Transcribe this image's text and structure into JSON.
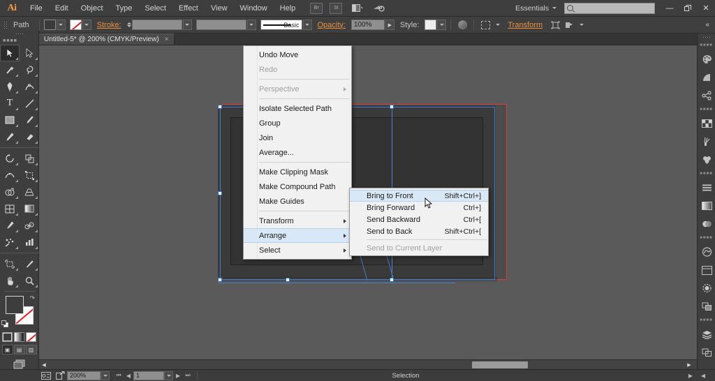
{
  "app": {
    "name": "Adobe Illustrator",
    "logo_text": "Ai"
  },
  "menubar": {
    "items": [
      {
        "label": "File"
      },
      {
        "label": "Edit"
      },
      {
        "label": "Object"
      },
      {
        "label": "Type"
      },
      {
        "label": "Select"
      },
      {
        "label": "Effect"
      },
      {
        "label": "View"
      },
      {
        "label": "Window"
      },
      {
        "label": "Help"
      }
    ],
    "bridge_label": "Br",
    "stock_label": "St",
    "workspace_label": "Essentials",
    "search_placeholder": "",
    "search_value": "",
    "window_minimize": "—",
    "window_restore": "❐",
    "window_close": "✕"
  },
  "controlbar": {
    "object_label": "Path",
    "stroke_label": "Stroke:",
    "stroke_weight": "",
    "stroke_profile": "",
    "brush_label": "Basic",
    "opacity_label": "Opacity:",
    "opacity_value": "100%",
    "style_label": "Style:",
    "transform_label": "Transform",
    "fill_color": "#3d3d3d",
    "stroke_color": "none"
  },
  "document": {
    "tab_title": "Untitled-5* @ 200% (CMYK/Preview)",
    "tab_close": "×"
  },
  "toolbar": {
    "tools": [
      {
        "name": "selection-tool",
        "glyph": "⬈",
        "active": true
      },
      {
        "name": "direct-selection-tool",
        "glyph": "⬈",
        "active": false
      },
      {
        "name": "magic-wand-tool",
        "glyph": "✦",
        "active": false
      },
      {
        "name": "lasso-tool",
        "glyph": "℘",
        "active": false
      },
      {
        "name": "pen-tool",
        "glyph": "✒",
        "active": false
      },
      {
        "name": "curvature-tool",
        "glyph": "∿",
        "active": false
      },
      {
        "name": "type-tool",
        "glyph": "T",
        "active": false
      },
      {
        "name": "line-segment-tool",
        "glyph": "╱",
        "active": false
      },
      {
        "name": "rectangle-tool",
        "glyph": "■",
        "active": false
      },
      {
        "name": "paintbrush-tool",
        "glyph": "✐",
        "active": false
      },
      {
        "name": "pencil-tool",
        "glyph": "✎",
        "active": false
      },
      {
        "name": "eraser-tool",
        "glyph": "▱",
        "active": false
      },
      {
        "name": "rotate-tool",
        "glyph": "↺",
        "active": false
      },
      {
        "name": "scale-tool",
        "glyph": "⧉",
        "active": false
      },
      {
        "name": "width-tool",
        "glyph": "∼",
        "active": false
      },
      {
        "name": "free-transform-tool",
        "glyph": "⬚",
        "active": false
      },
      {
        "name": "shape-builder-tool",
        "glyph": "◔",
        "active": false
      },
      {
        "name": "perspective-grid-tool",
        "glyph": "▦",
        "active": false
      },
      {
        "name": "mesh-tool",
        "glyph": "▓",
        "active": false
      },
      {
        "name": "gradient-tool",
        "glyph": "▧",
        "active": false
      },
      {
        "name": "eyedropper-tool",
        "glyph": "⚗",
        "active": false
      },
      {
        "name": "blend-tool",
        "glyph": "⦸",
        "active": false
      },
      {
        "name": "symbol-sprayer-tool",
        "glyph": "⁂",
        "active": false
      },
      {
        "name": "column-graph-tool",
        "glyph": "ᴵ",
        "active": false
      },
      {
        "name": "artboard-tool",
        "glyph": "⬚",
        "active": false
      },
      {
        "name": "slice-tool",
        "glyph": "╱",
        "active": false
      },
      {
        "name": "hand-tool",
        "glyph": "✋",
        "active": false
      },
      {
        "name": "zoom-tool",
        "glyph": "⚲",
        "active": false
      }
    ]
  },
  "canvas": {
    "artboard_border_color": "#e03b34",
    "artwork_fill": "#3a3a3a",
    "artwork_inner_fill": "#333333",
    "selection_color": "#3b7ddd"
  },
  "context_menu": {
    "items": [
      {
        "label": "Undo Move",
        "disabled": false,
        "submenu": false,
        "highlighted": false
      },
      {
        "label": "Redo",
        "disabled": true,
        "submenu": false,
        "highlighted": false
      },
      {
        "divider": true
      },
      {
        "label": "Perspective",
        "disabled": true,
        "submenu": true,
        "highlighted": false
      },
      {
        "divider": true
      },
      {
        "label": "Isolate Selected Path",
        "disabled": false,
        "submenu": false,
        "highlighted": false
      },
      {
        "label": "Group",
        "disabled": false,
        "submenu": false,
        "highlighted": false
      },
      {
        "label": "Join",
        "disabled": false,
        "submenu": false,
        "highlighted": false
      },
      {
        "label": "Average...",
        "disabled": false,
        "submenu": false,
        "highlighted": false
      },
      {
        "divider": true
      },
      {
        "label": "Make Clipping Mask",
        "disabled": false,
        "submenu": false,
        "highlighted": false
      },
      {
        "label": "Make Compound Path",
        "disabled": false,
        "submenu": false,
        "highlighted": false
      },
      {
        "label": "Make Guides",
        "disabled": false,
        "submenu": false,
        "highlighted": false
      },
      {
        "divider": true
      },
      {
        "label": "Transform",
        "disabled": false,
        "submenu": true,
        "highlighted": false
      },
      {
        "label": "Arrange",
        "disabled": false,
        "submenu": true,
        "highlighted": true
      },
      {
        "label": "Select",
        "disabled": false,
        "submenu": true,
        "highlighted": false
      }
    ]
  },
  "submenu": {
    "items": [
      {
        "label": "Bring to Front",
        "shortcut": "Shift+Ctrl+]",
        "disabled": false,
        "highlighted": true
      },
      {
        "label": "Bring Forward",
        "shortcut": "Ctrl+]",
        "disabled": false,
        "highlighted": false
      },
      {
        "label": "Send Backward",
        "shortcut": "Ctrl+[",
        "disabled": false,
        "highlighted": false
      },
      {
        "label": "Send to Back",
        "shortcut": "Shift+Ctrl+[",
        "disabled": false,
        "highlighted": false
      },
      {
        "divider": true
      },
      {
        "label": "Send to Current Layer",
        "shortcut": "",
        "disabled": true,
        "highlighted": false
      }
    ]
  },
  "statusbar": {
    "zoom_value": "200%",
    "artboard_value": "1",
    "status_text": "Selection",
    "first_page": "⏮",
    "prev_page": "◀",
    "next_page": "▶",
    "last_page": "⏭"
  },
  "dock": {
    "groups": [
      {
        "icons": [
          {
            "name": "color-panel-icon",
            "glyph": "◕"
          },
          {
            "name": "color-guide-panel-icon",
            "glyph": "◔"
          },
          {
            "name": "symbols-panel-icon",
            "glyph": "⁂"
          }
        ]
      },
      {
        "icons": [
          {
            "name": "swatches-panel-icon",
            "glyph": "▦"
          },
          {
            "name": "brushes-panel-icon",
            "glyph": "✐"
          },
          {
            "name": "graphic-styles-panel-icon",
            "glyph": "♣"
          }
        ]
      },
      {
        "icons": [
          {
            "name": "align-panel-icon",
            "glyph": "☰"
          },
          {
            "name": "gradient-panel-icon",
            "glyph": "▧"
          },
          {
            "name": "transparency-panel-icon",
            "glyph": "◍"
          }
        ]
      },
      {
        "icons": [
          {
            "name": "creative-cloud-panel-icon",
            "glyph": "∞"
          },
          {
            "name": "libraries-panel-icon",
            "glyph": "▣"
          },
          {
            "name": "appearance-panel-icon",
            "glyph": "◎"
          },
          {
            "name": "pathfinder-panel-icon",
            "glyph": "⧉"
          }
        ]
      },
      {
        "icons": [
          {
            "name": "layers-panel-icon",
            "glyph": "≣"
          },
          {
            "name": "artboards-panel-icon",
            "glyph": "⧉"
          }
        ]
      }
    ]
  }
}
